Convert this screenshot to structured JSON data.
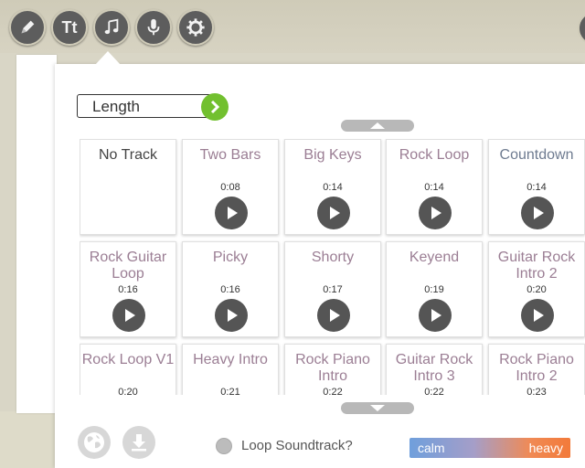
{
  "toolbar": {
    "tools": [
      {
        "icon": "pencil-icon"
      },
      {
        "icon": "text-icon",
        "label": "Tt"
      },
      {
        "icon": "music-note-icon"
      },
      {
        "icon": "microphone-icon"
      },
      {
        "icon": "gear-icon"
      }
    ]
  },
  "sort": {
    "label": "Length",
    "button_icon": "chevron-right-icon"
  },
  "tracks": [
    {
      "name": "No Track",
      "duration": ""
    },
    {
      "name": "Two Bars",
      "duration": "0:08"
    },
    {
      "name": "Big Keys",
      "duration": "0:14"
    },
    {
      "name": "Rock Loop",
      "duration": "0:14"
    },
    {
      "name": "Countdown",
      "duration": "0:14"
    },
    {
      "name": "Rock Guitar Loop",
      "duration": "0:16"
    },
    {
      "name": "Picky",
      "duration": "0:16"
    },
    {
      "name": "Shorty",
      "duration": "0:17"
    },
    {
      "name": "Keyend",
      "duration": "0:19"
    },
    {
      "name": "Guitar Rock Intro 2",
      "duration": "0:20"
    },
    {
      "name": "Rock Loop V1",
      "duration": "0:20"
    },
    {
      "name": "Heavy Intro",
      "duration": "0:21"
    },
    {
      "name": "Rock Piano Intro",
      "duration": "0:22"
    },
    {
      "name": "Guitar Rock Intro 3",
      "duration": "0:22"
    },
    {
      "name": "Rock Piano Intro 2",
      "duration": "0:23"
    }
  ],
  "footer": {
    "globe_icon": "globe-icon",
    "download_icon": "download-icon",
    "loop_label": "Loop Soundtrack?",
    "mood_low": "calm",
    "mood_high": "heavy"
  },
  "colors": {
    "accent_green": "#72c02f",
    "toolbar_dark": "#5d5d5d",
    "calm_blue": "#6f9fdc",
    "heavy_orange": "#f27a3a"
  }
}
